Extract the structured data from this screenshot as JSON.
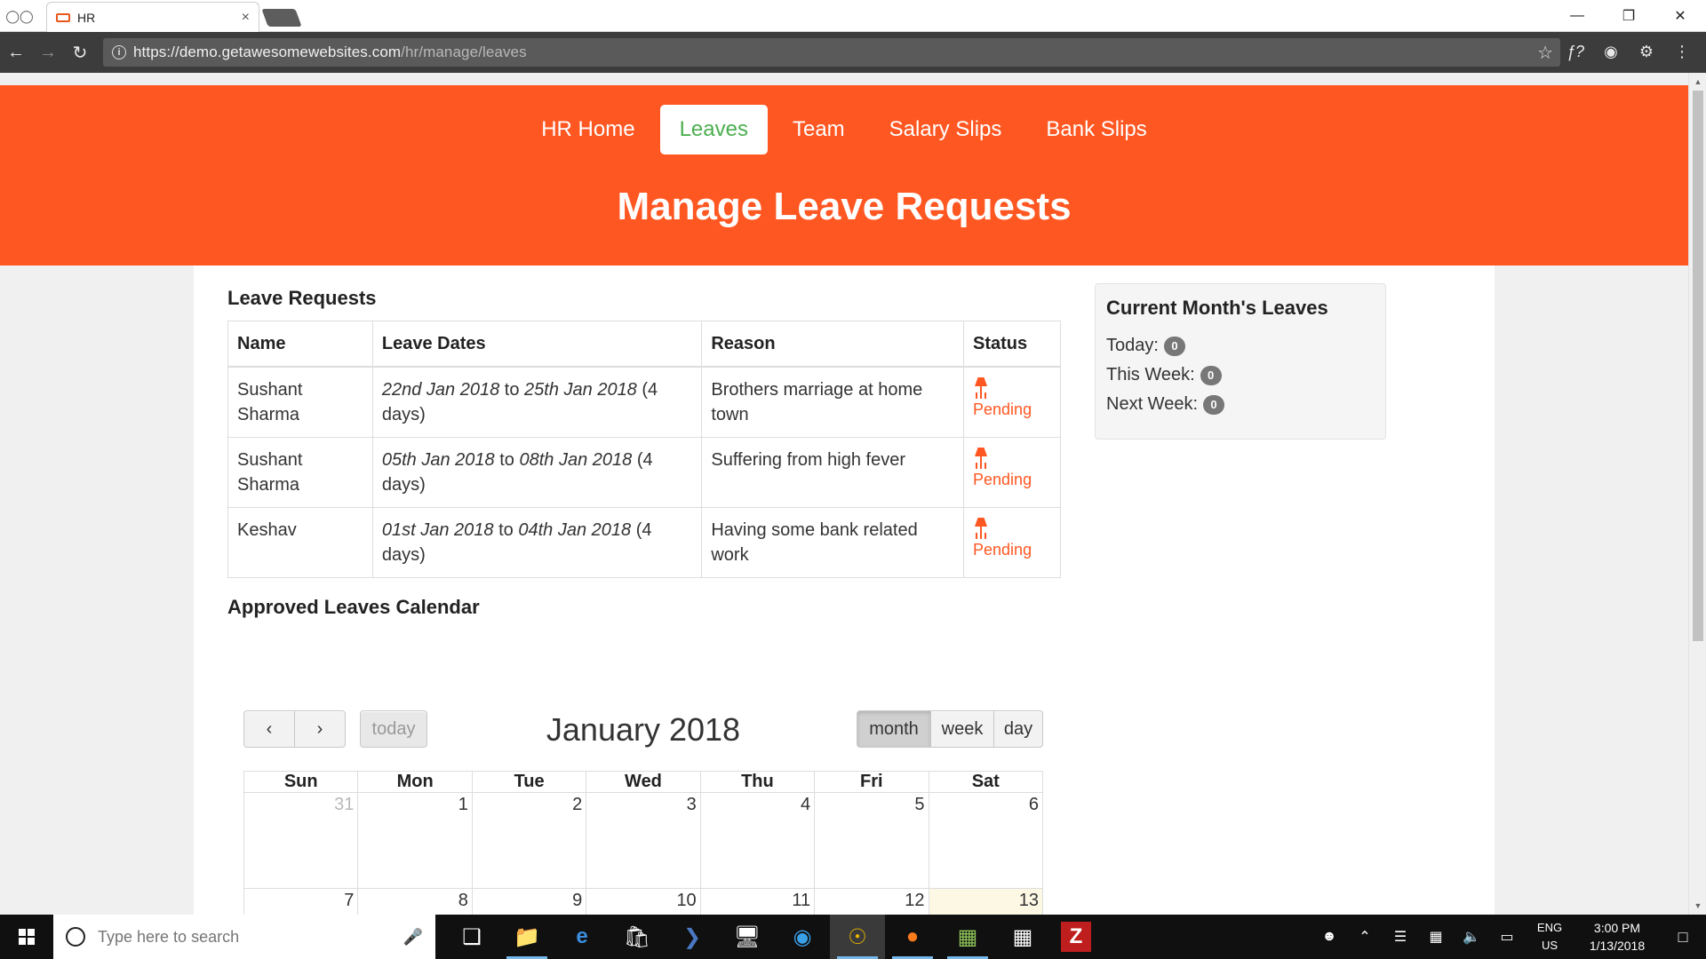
{
  "browser": {
    "tab_title": "HR",
    "tab_close": "×",
    "url_host": "https://demo.getawesomewebsites.com",
    "url_path": "/hr/manage/leaves"
  },
  "nav": {
    "items": [
      "HR Home",
      "Leaves",
      "Team",
      "Salary Slips",
      "Bank Slips"
    ],
    "active": "Leaves"
  },
  "page_title": "Manage Leave Requests",
  "leave_requests": {
    "title": "Leave Requests",
    "columns": [
      "Name",
      "Leave Dates",
      "Reason",
      "Status"
    ],
    "rows": [
      {
        "name": "Sushant Sharma",
        "from": "22nd Jan 2018",
        "to_word": "to",
        "to": "25th Jan 2018",
        "duration": "(4 days)",
        "reason": "Brothers marriage at home town",
        "status": "Pending"
      },
      {
        "name": "Sushant Sharma",
        "from": "05th Jan 2018",
        "to_word": "to",
        "to": "08th Jan 2018",
        "duration": "(4 days)",
        "reason": "Suffering from high fever",
        "status": "Pending"
      },
      {
        "name": "Keshav",
        "from": "01st Jan 2018",
        "to_word": "to",
        "to": "04th Jan 2018",
        "duration": "(4 days)",
        "reason": "Having some bank related work",
        "status": "Pending"
      }
    ]
  },
  "current_month": {
    "title": "Current Month's Leaves",
    "items": [
      {
        "label": "Today:",
        "count": "0"
      },
      {
        "label": "This Week:",
        "count": "0"
      },
      {
        "label": "Next Week:",
        "count": "0"
      }
    ]
  },
  "calendar": {
    "title": "Approved Leaves Calendar",
    "heading": "January 2018",
    "prev": "‹",
    "next": "›",
    "today": "today",
    "views": [
      "month",
      "week",
      "day"
    ],
    "active_view": "month",
    "weekdays": [
      "Sun",
      "Mon",
      "Tue",
      "Wed",
      "Thu",
      "Fri",
      "Sat"
    ],
    "weeks": [
      [
        "31",
        "1",
        "2",
        "3",
        "4",
        "5",
        "6"
      ],
      [
        "7",
        "8",
        "9",
        "10",
        "11",
        "12",
        "13"
      ]
    ],
    "highlighted_day": "13"
  },
  "taskbar": {
    "search_placeholder": "Type here to search",
    "lang_top": "ENG",
    "lang_bottom": "US",
    "time": "3:00 PM",
    "date": "1/13/2018"
  },
  "colors": {
    "brand": "#ff5722",
    "active_nav_text": "#4caf50",
    "today_cell": "#fcf8e3"
  }
}
